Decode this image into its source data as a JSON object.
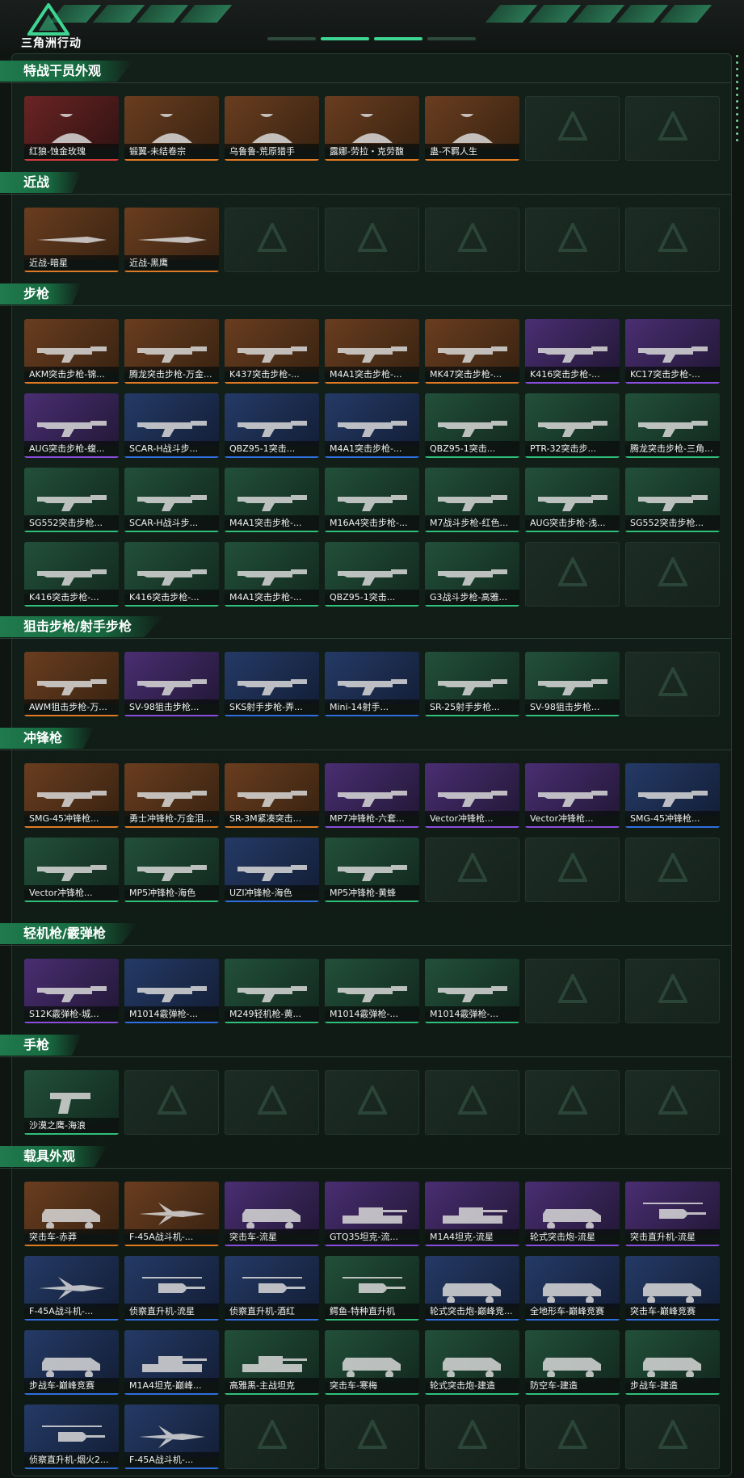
{
  "header": {
    "title": "三角洲行动"
  },
  "rarity_colors": {
    "orange": "#e07a22",
    "red": "#d33a3a",
    "purple": "#8b4de0",
    "blue": "#2f6fe0",
    "green": "#2fc07a"
  },
  "sections": [
    {
      "title": "特战干员外观",
      "empty_slots": 2,
      "items": [
        {
          "label": "红狼-蚀金玫瑰",
          "rarity": "red",
          "icon": "operator-portrait"
        },
        {
          "label": "锻翼-未结卷宗",
          "rarity": "orange",
          "icon": "operator-portrait"
        },
        {
          "label": "乌鲁鲁-荒原猎手",
          "rarity": "orange",
          "icon": "operator-portrait"
        },
        {
          "label": "露娜-劳拉・克劳馥",
          "rarity": "orange",
          "icon": "operator-portrait"
        },
        {
          "label": "蛊-不羁人生",
          "rarity": "orange",
          "icon": "operator-portrait"
        }
      ]
    },
    {
      "title": "近战",
      "empty_slots": 5,
      "items": [
        {
          "label": "近战-暗星",
          "rarity": "orange",
          "icon": "knife-icon"
        },
        {
          "label": "近战-黑鹰",
          "rarity": "orange",
          "icon": "knife-icon"
        }
      ]
    },
    {
      "title": "步枪",
      "empty_slots": 2,
      "items": [
        {
          "label": "AKM突击步枪-锦...",
          "rarity": "orange",
          "icon": "rifle-icon"
        },
        {
          "label": "腾龙突击步枪-万金...",
          "rarity": "orange",
          "icon": "rifle-icon"
        },
        {
          "label": "K437突击步枪-...",
          "rarity": "orange",
          "icon": "rifle-icon"
        },
        {
          "label": "M4A1突击步枪-...",
          "rarity": "orange",
          "icon": "rifle-icon"
        },
        {
          "label": "MK47突击步枪-...",
          "rarity": "orange",
          "icon": "rifle-icon"
        },
        {
          "label": "K416突击步枪-...",
          "rarity": "purple",
          "icon": "rifle-icon"
        },
        {
          "label": "KC17突击步枪-...",
          "rarity": "purple",
          "icon": "rifle-icon"
        },
        {
          "label": "AUG突击步枪-蝮...",
          "rarity": "purple",
          "icon": "rifle-icon"
        },
        {
          "label": "SCAR-H战斗步...",
          "rarity": "blue",
          "icon": "rifle-icon"
        },
        {
          "label": "QBZ95-1突击...",
          "rarity": "blue",
          "icon": "rifle-icon"
        },
        {
          "label": "M4A1突击步枪-...",
          "rarity": "blue",
          "icon": "rifle-icon"
        },
        {
          "label": "QBZ95-1突击...",
          "rarity": "green",
          "icon": "rifle-icon"
        },
        {
          "label": "PTR-32突击步...",
          "rarity": "green",
          "icon": "rifle-icon"
        },
        {
          "label": "腾龙突击步枪-三角...",
          "rarity": "green",
          "icon": "rifle-icon"
        },
        {
          "label": "SG552突击步枪...",
          "rarity": "green",
          "icon": "rifle-icon"
        },
        {
          "label": "SCAR-H战斗步...",
          "rarity": "green",
          "icon": "rifle-icon"
        },
        {
          "label": "M4A1突击步枪-...",
          "rarity": "green",
          "icon": "rifle-icon"
        },
        {
          "label": "M16A4突击步枪-...",
          "rarity": "green",
          "icon": "rifle-icon"
        },
        {
          "label": "M7战斗步枪-红色...",
          "rarity": "green",
          "icon": "rifle-icon"
        },
        {
          "label": "AUG突击步枪-浅...",
          "rarity": "green",
          "icon": "rifle-icon"
        },
        {
          "label": "SG552突击步枪...",
          "rarity": "green",
          "icon": "rifle-icon"
        },
        {
          "label": "K416突击步枪-...",
          "rarity": "green",
          "icon": "rifle-icon"
        },
        {
          "label": "K416突击步枪-...",
          "rarity": "green",
          "icon": "rifle-icon"
        },
        {
          "label": "M4A1突击步枪-...",
          "rarity": "green",
          "icon": "rifle-icon"
        },
        {
          "label": "QBZ95-1突击...",
          "rarity": "green",
          "icon": "rifle-icon"
        },
        {
          "label": "G3战斗步枪-高雅...",
          "rarity": "green",
          "icon": "rifle-icon"
        }
      ]
    },
    {
      "title": "狙击步枪/射手步枪",
      "empty_slots": 1,
      "items": [
        {
          "label": "AWM狙击步枪-万...",
          "rarity": "orange",
          "icon": "sniper-icon"
        },
        {
          "label": "SV-98狙击步枪...",
          "rarity": "purple",
          "icon": "sniper-icon"
        },
        {
          "label": "SKS射手步枪-弄...",
          "rarity": "blue",
          "icon": "sniper-icon"
        },
        {
          "label": "Mini-14射手...",
          "rarity": "blue",
          "icon": "sniper-icon"
        },
        {
          "label": "SR-25射手步枪...",
          "rarity": "green",
          "icon": "sniper-icon"
        },
        {
          "label": "SV-98狙击步枪...",
          "rarity": "green",
          "icon": "sniper-icon"
        }
      ]
    },
    {
      "title": "冲锋枪",
      "empty_slots": 3,
      "items": [
        {
          "label": "SMG-45冲锋枪...",
          "rarity": "orange",
          "icon": "smg-icon"
        },
        {
          "label": "勇士冲锋枪-万金泪...",
          "rarity": "orange",
          "icon": "smg-icon"
        },
        {
          "label": "SR-3M紧凑突击...",
          "rarity": "orange",
          "icon": "smg-icon"
        },
        {
          "label": "MP7冲锋枪-六套...",
          "rarity": "purple",
          "icon": "smg-icon"
        },
        {
          "label": "Vector冲锋枪...",
          "rarity": "purple",
          "icon": "smg-icon"
        },
        {
          "label": "Vector冲锋枪...",
          "rarity": "purple",
          "icon": "smg-icon"
        },
        {
          "label": "SMG-45冲锋枪...",
          "rarity": "blue",
          "icon": "smg-icon"
        },
        {
          "label": "Vector冲锋枪...",
          "rarity": "green",
          "icon": "smg-icon"
        },
        {
          "label": "MP5冲锋枪-海色",
          "rarity": "green",
          "icon": "smg-icon"
        },
        {
          "label": "UZI冲锋枪-海色",
          "rarity": "blue",
          "icon": "smg-icon"
        },
        {
          "label": "MP5冲锋枪-黄蜂",
          "rarity": "green",
          "icon": "smg-icon"
        }
      ]
    },
    {
      "title": "轻机枪/霰弹枪",
      "empty_slots": 2,
      "items": [
        {
          "label": "S12K霰弹枪-城...",
          "rarity": "purple",
          "icon": "shotgun-icon"
        },
        {
          "label": "M1014霰弹枪-...",
          "rarity": "blue",
          "icon": "shotgun-icon"
        },
        {
          "label": "M249轻机枪-黄...",
          "rarity": "green",
          "icon": "lmg-icon"
        },
        {
          "label": "M1014霰弹枪-...",
          "rarity": "green",
          "icon": "shotgun-icon"
        },
        {
          "label": "M1014霰弹枪-...",
          "rarity": "green",
          "icon": "shotgun-icon"
        }
      ]
    },
    {
      "title": "手枪",
      "empty_slots": 6,
      "items": [
        {
          "label": "沙漠之鹰-海浪",
          "rarity": "green",
          "icon": "pistol-icon"
        }
      ]
    },
    {
      "title": "载具外观",
      "empty_slots": 5,
      "items": [
        {
          "label": "突击车-赤莽",
          "rarity": "orange",
          "icon": "vehicle-icon"
        },
        {
          "label": "F-45A战斗机-...",
          "rarity": "orange",
          "icon": "jet-icon"
        },
        {
          "label": "突击车-流星",
          "rarity": "purple",
          "icon": "vehicle-icon"
        },
        {
          "label": "GTQ35坦克-流...",
          "rarity": "purple",
          "icon": "tank-icon"
        },
        {
          "label": "M1A4坦克-流星",
          "rarity": "purple",
          "icon": "tank-icon"
        },
        {
          "label": "轮式突击炮-流星",
          "rarity": "purple",
          "icon": "vehicle-icon"
        },
        {
          "label": "突击直升机-流星",
          "rarity": "purple",
          "icon": "helicopter-icon"
        },
        {
          "label": "F-45A战斗机-...",
          "rarity": "blue",
          "icon": "jet-icon"
        },
        {
          "label": "侦察直升机-流星",
          "rarity": "blue",
          "icon": "helicopter-icon"
        },
        {
          "label": "侦察直升机-酒红",
          "rarity": "blue",
          "icon": "helicopter-icon"
        },
        {
          "label": "鳄鱼-特种直升机",
          "rarity": "green",
          "icon": "helicopter-icon"
        },
        {
          "label": "轮式突击炮-巅峰竞...",
          "rarity": "blue",
          "icon": "vehicle-icon"
        },
        {
          "label": "全地形车-巅峰竞赛",
          "rarity": "blue",
          "icon": "vehicle-icon"
        },
        {
          "label": "突击车-巅峰竞赛",
          "rarity": "blue",
          "icon": "vehicle-icon"
        },
        {
          "label": "步战车-巅峰竞赛",
          "rarity": "blue",
          "icon": "vehicle-icon"
        },
        {
          "label": "M1A4坦克-巅峰...",
          "rarity": "blue",
          "icon": "tank-icon"
        },
        {
          "label": "高雅黑-主战坦克",
          "rarity": "green",
          "icon": "tank-icon"
        },
        {
          "label": "突击车-寒梅",
          "rarity": "green",
          "icon": "vehicle-icon"
        },
        {
          "label": "轮式突击炮-建造",
          "rarity": "green",
          "icon": "vehicle-icon"
        },
        {
          "label": "防空车-建造",
          "rarity": "green",
          "icon": "vehicle-icon"
        },
        {
          "label": "步战车-建造",
          "rarity": "green",
          "icon": "vehicle-icon"
        },
        {
          "label": "侦察直升机-烟火2...",
          "rarity": "blue",
          "icon": "helicopter-icon"
        },
        {
          "label": "F-45A战斗机-...",
          "rarity": "blue",
          "icon": "jet-icon"
        }
      ]
    }
  ]
}
